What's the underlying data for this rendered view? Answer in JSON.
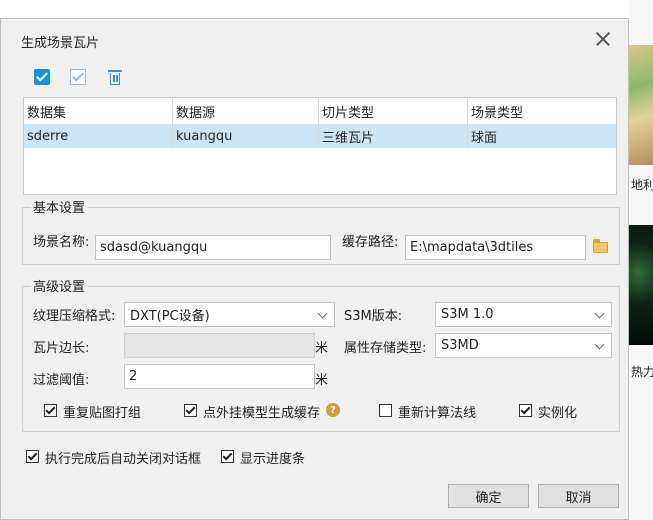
{
  "dialog": {
    "title": "生成场景瓦片"
  },
  "toolbar": {
    "select_all_icon": "checkbox-checked-icon",
    "unselect_icon": "checkbox-unchecked-icon",
    "delete_icon": "trash-icon"
  },
  "table": {
    "columns": [
      "数据集",
      "数据源",
      "切片类型",
      "场景类型"
    ],
    "rows": [
      [
        "sderre",
        "kuangqu",
        "三维瓦片",
        "球面"
      ]
    ]
  },
  "basic": {
    "title": "基本设置",
    "scene_name_label": "场景名称:",
    "scene_name_value": "sdasd@kuangqu",
    "cache_path_label": "缓存路径:",
    "cache_path_value": "E:\\mapdata\\3dtiles"
  },
  "advanced": {
    "title": "高级设置",
    "texture_label": "纹理压缩格式:",
    "texture_value": "DXT(PC设备)",
    "s3m_label": "S3M版本:",
    "s3m_value": "S3M 1.0",
    "tile_edge_label": "瓦片边长:",
    "tile_edge_value": "",
    "meter_unit": "米",
    "attr_storage_label": "属性存储类型:",
    "attr_storage_value": "S3MD",
    "filter_label": "过滤阈值:",
    "filter_value": "2",
    "options": [
      {
        "label": "重复贴图打组",
        "checked": true
      },
      {
        "label": "点外挂模型生成缓存",
        "checked": true
      },
      {
        "label": "重新计算法线",
        "checked": false
      },
      {
        "label": "实例化",
        "checked": true
      }
    ]
  },
  "footer": {
    "auto_close_label": "执行完成后自动关闭对话框",
    "auto_close_checked": true,
    "show_progress_label": "显示进度条",
    "show_progress_checked": true,
    "ok_label": "确定",
    "cancel_label": "取消"
  },
  "background": {
    "text_1": "地利",
    "text_2": "热力"
  },
  "colors": {
    "accent": "#1d8fe0",
    "selected_row": "#cde6f7",
    "dialog_bg": "#f0f0f0"
  }
}
